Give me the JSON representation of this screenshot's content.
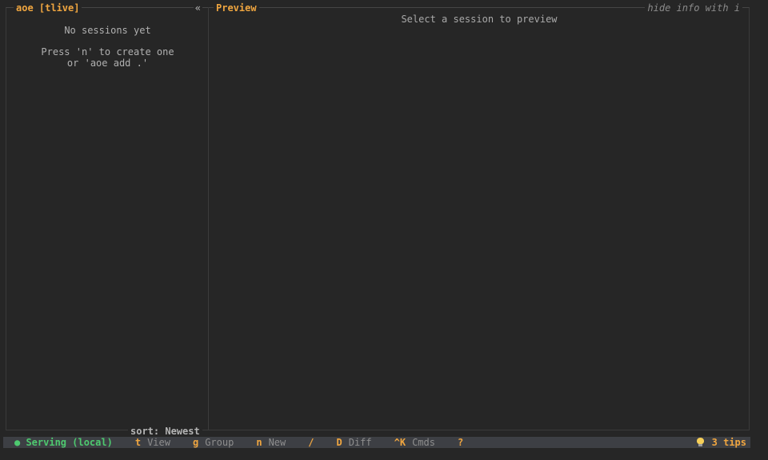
{
  "sidebar": {
    "title": "aoe [tlive]",
    "collapse_glyph": "«",
    "empty_line1": "No sessions yet",
    "empty_line2": "Press 'n' to create one",
    "empty_line3": "or 'aoe add .'",
    "sort_label": "sort: Newest"
  },
  "preview": {
    "title": "Preview",
    "hint": "hide info with i",
    "placeholder": "Select a session to preview"
  },
  "statusbar": {
    "serving": "● Serving (local)",
    "shortcuts": [
      {
        "key": "t",
        "label": "View"
      },
      {
        "key": "g",
        "label": "Group"
      },
      {
        "key": "n",
        "label": "New"
      },
      {
        "key": "/",
        "label": ""
      },
      {
        "key": "D",
        "label": "Diff"
      },
      {
        "key": "^K",
        "label": "Cmds"
      },
      {
        "key": "?",
        "label": ""
      }
    ],
    "tips": "3 tips"
  },
  "colors": {
    "accent": "#f0a640",
    "serving": "#4ec96f",
    "background": "#262626",
    "statusbar": "#3d3f44"
  }
}
